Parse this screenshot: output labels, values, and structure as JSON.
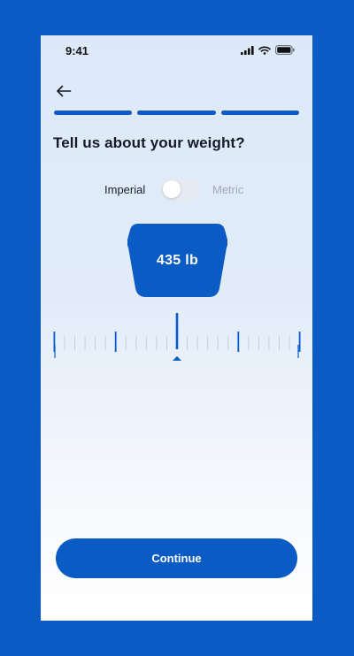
{
  "status_bar": {
    "time": "9:41"
  },
  "header": {
    "back_icon": "arrow-left-icon",
    "progress_steps": 3,
    "progress_completed": 3
  },
  "question": "Tell us about your weight?",
  "unit_toggle": {
    "left_label": "Imperial",
    "right_label": "Metric",
    "selected": "Imperial"
  },
  "weight": {
    "display": "435 lb",
    "value": 435,
    "unit": "lb"
  },
  "actions": {
    "continue_label": "Continue"
  },
  "colors": {
    "accent": "#0a5bc4",
    "background": "#dde9f9",
    "text": "#141a26",
    "muted": "#a3a9b3"
  }
}
